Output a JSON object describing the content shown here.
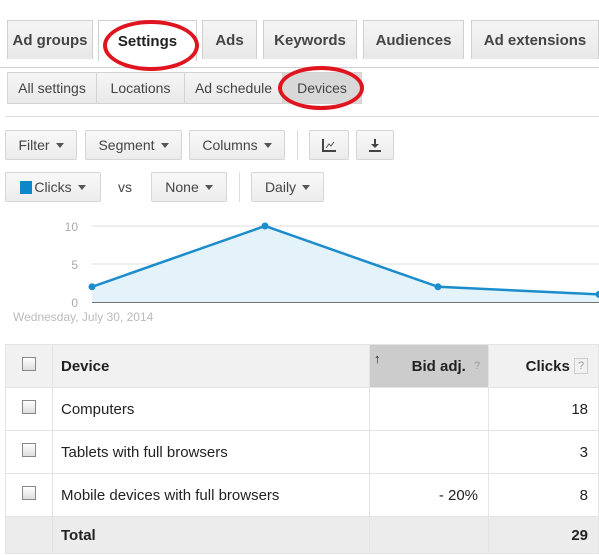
{
  "tabs": [
    {
      "label": "Ad groups"
    },
    {
      "label": "Settings",
      "active": true
    },
    {
      "label": "Ads"
    },
    {
      "label": "Keywords"
    },
    {
      "label": "Audiences"
    },
    {
      "label": "Ad extensions"
    }
  ],
  "subtabs": [
    {
      "label": "All settings"
    },
    {
      "label": "Locations"
    },
    {
      "label": "Ad schedule"
    },
    {
      "label": "Devices",
      "active": true
    }
  ],
  "toolbar": {
    "filter": "Filter",
    "segment": "Segment",
    "columns": "Columns",
    "chart_icon": "line-chart-icon",
    "download_icon": "download-icon"
  },
  "chart_controls": {
    "metric1": "Clicks",
    "metric1_color": "#0c87c9",
    "vs": "vs",
    "metric2": "None",
    "period": "Daily"
  },
  "annotations": {
    "highlight_color": "#e0141e"
  },
  "chart_data": {
    "type": "area",
    "x": [
      "",
      "",
      "",
      ""
    ],
    "values": [
      2,
      10,
      2,
      1
    ],
    "yticks": [
      0,
      5,
      10
    ],
    "ylim": [
      0,
      10
    ],
    "start_label": "Wednesday, July 30, 2014",
    "line_color": "#1b8dcc",
    "fill_color": "#e4f2f9",
    "grid": true
  },
  "table": {
    "headers": {
      "device": "Device",
      "bid": "Bid adj.",
      "clicks": "Clicks",
      "help": "?",
      "sort_icon": "arrow-up-icon"
    },
    "rows": [
      {
        "device": "Computers",
        "bid": "",
        "clicks": "18"
      },
      {
        "device": "Tablets with full browsers",
        "bid": "",
        "clicks": "3"
      },
      {
        "device": "Mobile devices with full browsers",
        "bid": "- 20%",
        "clicks": "8"
      }
    ],
    "total": {
      "label": "Total",
      "clicks": "29"
    }
  }
}
